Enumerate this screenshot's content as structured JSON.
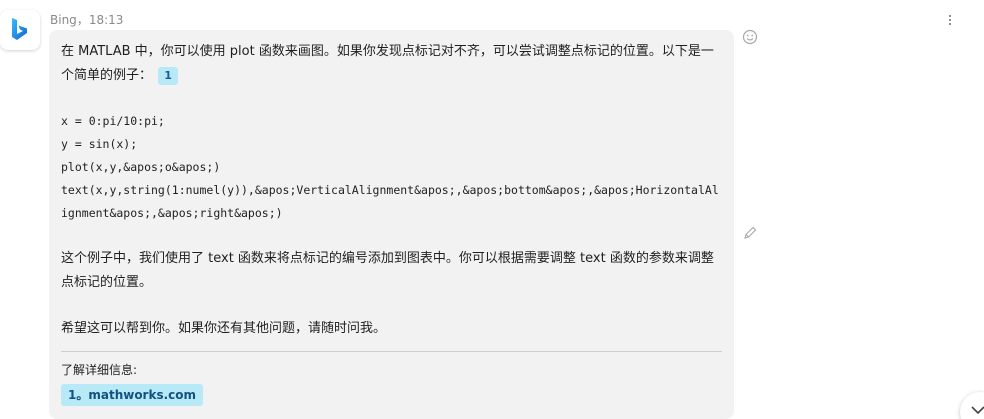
{
  "message": {
    "sender": "Bing",
    "time": "18:13",
    "meta_sep": "，",
    "intro": "在 MATLAB 中，你可以使用 plot 函数来画图。如果你发现点标记对不齐，可以尝试调整点标记的位置。以下是一个简单的例子：",
    "citation_number": "1",
    "code_lines": [
      "x = 0:pi/10:pi;",
      "y = sin(x);",
      "plot(x,y,&apos;o&apos;)",
      "text(x,y,string(1:numel(y)),&apos;VerticalAlignment&apos;,&apos;bottom&apos;,&apos;HorizontalAlignment&apos;,&apos;right&apos;)"
    ],
    "explanation": "这个例子中，我们使用了 text 函数来将点标记的编号添加到图表中。你可以根据需要调整 text 函数的参数来调整点标记的位置。",
    "closing": "希望这可以帮到你。如果你还有其他问题，请随时问我。",
    "learn_more_label": "了解详细信息:",
    "sources": [
      "1。mathworks.com"
    ]
  },
  "icons": {
    "avatar": "bing-logo-icon",
    "emoji": "smiley-icon",
    "edit": "pencil-icon",
    "more": "more-vertical-icon",
    "scroll": "chevron-down-icon"
  },
  "colors": {
    "bubble": "#f2f2f2",
    "chip": "#b7eaf6",
    "brand": "#1a6fd4"
  }
}
